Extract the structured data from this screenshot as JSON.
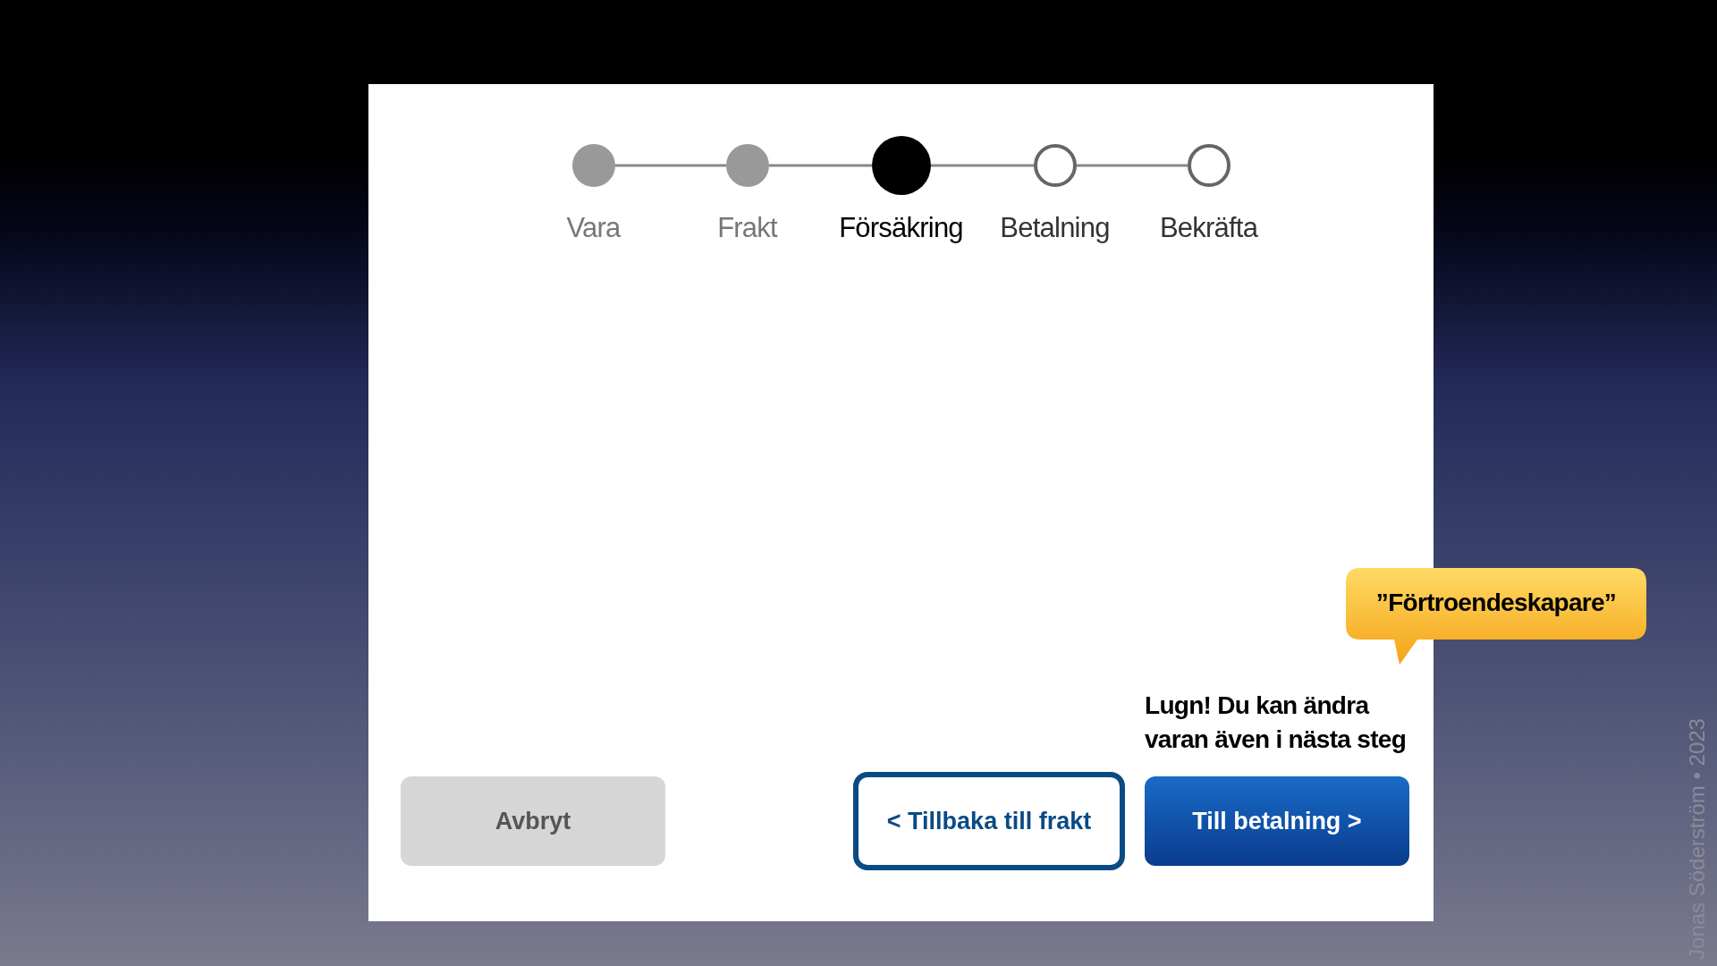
{
  "steps": [
    {
      "label": "Vara",
      "completed": true,
      "selected": false
    },
    {
      "label": "Frakt",
      "completed": true,
      "selected": false
    },
    {
      "label": "Försäkring",
      "completed": false,
      "selected": true
    },
    {
      "label": "Betalning",
      "completed": false,
      "selected": false
    },
    {
      "label": "Bekräfta",
      "completed": false,
      "selected": false
    }
  ],
  "callout": "”Förtroendeskapare”",
  "note": "Lugn! Du kan ändra varan även i nästa steg",
  "buttons": [
    {
      "label": "Avbryt",
      "kind": "cancel"
    },
    {
      "label": "< Tillbaka till frakt",
      "kind": "back"
    },
    {
      "label": "Till betalning >",
      "kind": "next"
    }
  ],
  "credit": "Jonas Söderström • 2023"
}
